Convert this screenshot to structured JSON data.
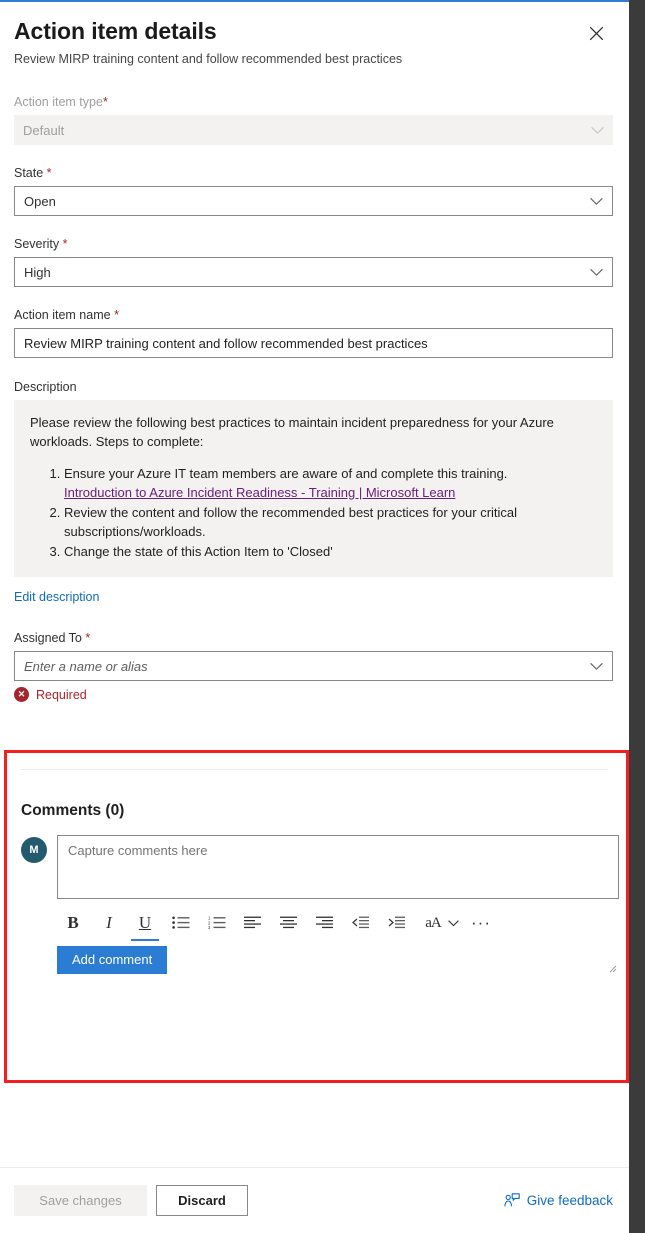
{
  "panel": {
    "title": "Action item details",
    "subtitle": "Review MIRP training content and follow recommended best practices",
    "close_label": "Close"
  },
  "fields": {
    "action_item_type": {
      "label": "Action item type",
      "required_marker": "*",
      "value": "Default",
      "disabled": true
    },
    "state": {
      "label": "State",
      "required_marker": "*",
      "value": "Open"
    },
    "severity": {
      "label": "Severity",
      "required_marker": "*",
      "value": "High"
    },
    "action_item_name": {
      "label": "Action item name",
      "required_marker": "*",
      "value": "Review MIRP training content and follow recommended best practices"
    },
    "assigned_to": {
      "label": "Assigned To",
      "required_marker": "*",
      "value": "",
      "placeholder": "Enter a name or alias",
      "error": "Required",
      "error_icon": "error-circle-icon"
    }
  },
  "description": {
    "label": "Description",
    "intro": "Please review the following best practices to maintain incident preparedness for your Azure workloads. Steps to complete:",
    "steps": [
      {
        "text": "Ensure your Azure IT team members are aware of and complete this training.",
        "link": "Introduction to Azure Incident Readiness - Training | Microsoft Learn"
      },
      {
        "text": "Review the content and follow the recommended best practices for your critical subscriptions/workloads.",
        "link": ""
      },
      {
        "text": "Change the state of this Action Item to 'Closed'",
        "link": ""
      }
    ],
    "edit_link": "Edit description"
  },
  "comments": {
    "heading": "Comments (0)",
    "count": 0,
    "avatar_initial": "M",
    "compose_placeholder": "Capture comments here",
    "compose_value": "",
    "add_button": "Add comment",
    "toolbar": [
      {
        "name": "bold-icon",
        "label": "Bold",
        "glyph": "B"
      },
      {
        "name": "italic-icon",
        "label": "Italic",
        "glyph": "I"
      },
      {
        "name": "underline-icon",
        "label": "Underline",
        "glyph": "U"
      },
      {
        "name": "bulleted-list-icon",
        "label": "Bulleted list",
        "glyph": ""
      },
      {
        "name": "numbered-list-icon",
        "label": "Numbered list",
        "glyph": ""
      },
      {
        "name": "align-left-icon",
        "label": "Align left",
        "glyph": ""
      },
      {
        "name": "align-center-icon",
        "label": "Align center",
        "glyph": ""
      },
      {
        "name": "align-right-icon",
        "label": "Align right",
        "glyph": ""
      },
      {
        "name": "decrease-indent-icon",
        "label": "Decrease indent",
        "glyph": ""
      },
      {
        "name": "increase-indent-icon",
        "label": "Increase indent",
        "glyph": ""
      },
      {
        "name": "font-size-icon",
        "label": "Font size",
        "glyph": "aA"
      },
      {
        "name": "more-options-icon",
        "label": "More options",
        "glyph": "···"
      }
    ]
  },
  "footer": {
    "save_label": "Save changes",
    "discard_label": "Discard",
    "feedback_label": "Give feedback",
    "feedback_icon": "feedback-person-icon"
  },
  "colors": {
    "accent_blue": "#2e7cd6",
    "link_blue": "#0f6cbd",
    "visited_link_purple": "#68217a",
    "error_red": "#a4262c",
    "highlight_red": "#f42020",
    "avatar_teal": "#235a6e",
    "button_blue": "#2b7cd3",
    "right_strip_dark": "#3b3b3b"
  }
}
